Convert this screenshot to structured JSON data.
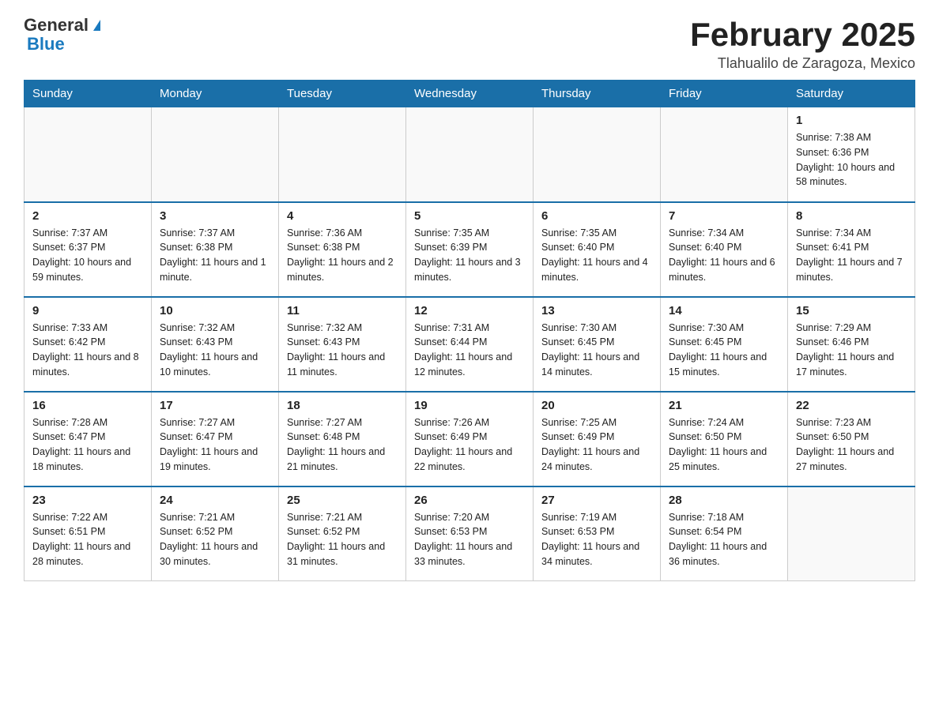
{
  "header": {
    "logo_general": "General",
    "logo_blue": "Blue",
    "title": "February 2025",
    "location": "Tlahualilo de Zaragoza, Mexico"
  },
  "weekdays": [
    "Sunday",
    "Monday",
    "Tuesday",
    "Wednesday",
    "Thursday",
    "Friday",
    "Saturday"
  ],
  "weeks": [
    [
      {
        "day": "",
        "info": ""
      },
      {
        "day": "",
        "info": ""
      },
      {
        "day": "",
        "info": ""
      },
      {
        "day": "",
        "info": ""
      },
      {
        "day": "",
        "info": ""
      },
      {
        "day": "",
        "info": ""
      },
      {
        "day": "1",
        "info": "Sunrise: 7:38 AM\nSunset: 6:36 PM\nDaylight: 10 hours and 58 minutes."
      }
    ],
    [
      {
        "day": "2",
        "info": "Sunrise: 7:37 AM\nSunset: 6:37 PM\nDaylight: 10 hours and 59 minutes."
      },
      {
        "day": "3",
        "info": "Sunrise: 7:37 AM\nSunset: 6:38 PM\nDaylight: 11 hours and 1 minute."
      },
      {
        "day": "4",
        "info": "Sunrise: 7:36 AM\nSunset: 6:38 PM\nDaylight: 11 hours and 2 minutes."
      },
      {
        "day": "5",
        "info": "Sunrise: 7:35 AM\nSunset: 6:39 PM\nDaylight: 11 hours and 3 minutes."
      },
      {
        "day": "6",
        "info": "Sunrise: 7:35 AM\nSunset: 6:40 PM\nDaylight: 11 hours and 4 minutes."
      },
      {
        "day": "7",
        "info": "Sunrise: 7:34 AM\nSunset: 6:40 PM\nDaylight: 11 hours and 6 minutes."
      },
      {
        "day": "8",
        "info": "Sunrise: 7:34 AM\nSunset: 6:41 PM\nDaylight: 11 hours and 7 minutes."
      }
    ],
    [
      {
        "day": "9",
        "info": "Sunrise: 7:33 AM\nSunset: 6:42 PM\nDaylight: 11 hours and 8 minutes."
      },
      {
        "day": "10",
        "info": "Sunrise: 7:32 AM\nSunset: 6:43 PM\nDaylight: 11 hours and 10 minutes."
      },
      {
        "day": "11",
        "info": "Sunrise: 7:32 AM\nSunset: 6:43 PM\nDaylight: 11 hours and 11 minutes."
      },
      {
        "day": "12",
        "info": "Sunrise: 7:31 AM\nSunset: 6:44 PM\nDaylight: 11 hours and 12 minutes."
      },
      {
        "day": "13",
        "info": "Sunrise: 7:30 AM\nSunset: 6:45 PM\nDaylight: 11 hours and 14 minutes."
      },
      {
        "day": "14",
        "info": "Sunrise: 7:30 AM\nSunset: 6:45 PM\nDaylight: 11 hours and 15 minutes."
      },
      {
        "day": "15",
        "info": "Sunrise: 7:29 AM\nSunset: 6:46 PM\nDaylight: 11 hours and 17 minutes."
      }
    ],
    [
      {
        "day": "16",
        "info": "Sunrise: 7:28 AM\nSunset: 6:47 PM\nDaylight: 11 hours and 18 minutes."
      },
      {
        "day": "17",
        "info": "Sunrise: 7:27 AM\nSunset: 6:47 PM\nDaylight: 11 hours and 19 minutes."
      },
      {
        "day": "18",
        "info": "Sunrise: 7:27 AM\nSunset: 6:48 PM\nDaylight: 11 hours and 21 minutes."
      },
      {
        "day": "19",
        "info": "Sunrise: 7:26 AM\nSunset: 6:49 PM\nDaylight: 11 hours and 22 minutes."
      },
      {
        "day": "20",
        "info": "Sunrise: 7:25 AM\nSunset: 6:49 PM\nDaylight: 11 hours and 24 minutes."
      },
      {
        "day": "21",
        "info": "Sunrise: 7:24 AM\nSunset: 6:50 PM\nDaylight: 11 hours and 25 minutes."
      },
      {
        "day": "22",
        "info": "Sunrise: 7:23 AM\nSunset: 6:50 PM\nDaylight: 11 hours and 27 minutes."
      }
    ],
    [
      {
        "day": "23",
        "info": "Sunrise: 7:22 AM\nSunset: 6:51 PM\nDaylight: 11 hours and 28 minutes."
      },
      {
        "day": "24",
        "info": "Sunrise: 7:21 AM\nSunset: 6:52 PM\nDaylight: 11 hours and 30 minutes."
      },
      {
        "day": "25",
        "info": "Sunrise: 7:21 AM\nSunset: 6:52 PM\nDaylight: 11 hours and 31 minutes."
      },
      {
        "day": "26",
        "info": "Sunrise: 7:20 AM\nSunset: 6:53 PM\nDaylight: 11 hours and 33 minutes."
      },
      {
        "day": "27",
        "info": "Sunrise: 7:19 AM\nSunset: 6:53 PM\nDaylight: 11 hours and 34 minutes."
      },
      {
        "day": "28",
        "info": "Sunrise: 7:18 AM\nSunset: 6:54 PM\nDaylight: 11 hours and 36 minutes."
      },
      {
        "day": "",
        "info": ""
      }
    ]
  ]
}
